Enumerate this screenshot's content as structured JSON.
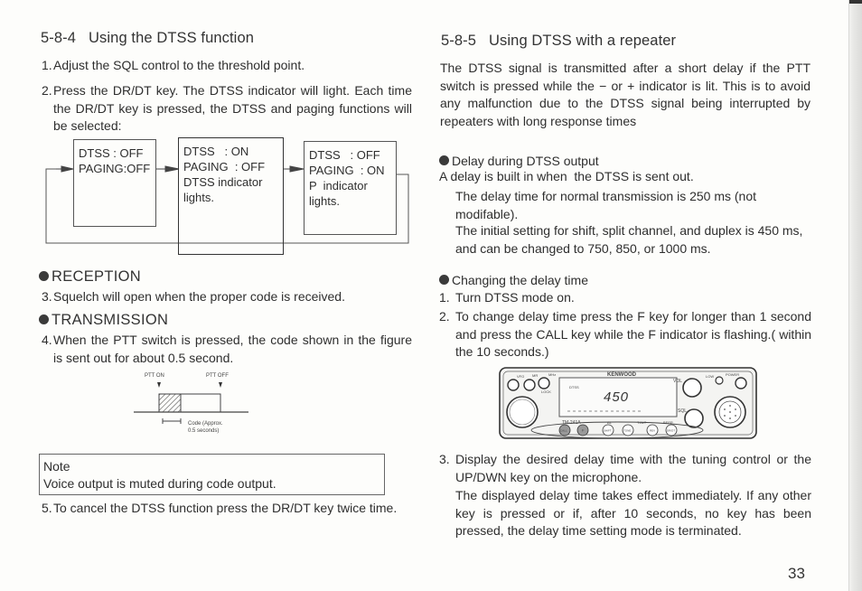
{
  "left_page": {
    "section": {
      "number": "5-8-4",
      "title": "Using the DTSS function"
    },
    "steps": [
      {
        "n": "1.",
        "text": "Adjust the SQL control to the threshold point."
      },
      {
        "n": "2.",
        "text": "Press the DR/DT key. The DTSS indicator will light. Each time the DR/DT key is pressed, the DTSS and paging functions will be selected:"
      }
    ],
    "diagram": {
      "states": [
        {
          "lines": [
            "DTSS : OFF",
            "PAGING:OFF"
          ]
        },
        {
          "lines": [
            "DTSS   : ON",
            "PAGING  : OFF",
            "DTSS indicator",
            "lights."
          ]
        },
        {
          "lines": [
            "DTSS   : OFF",
            "PAGING  : ON",
            "P  indicator",
            "lights."
          ]
        }
      ]
    },
    "reception": {
      "heading": "RECEPTION",
      "step": {
        "n": "3.",
        "text": "Squelch will open when the proper code is received."
      }
    },
    "transmission": {
      "heading": "TRANSMISSION",
      "step": {
        "n": "4.",
        "text": "When the PTT switch is pressed, the code shown in the figure is sent out for about 0.5 second."
      }
    },
    "timing_figure": {
      "ptt_on": "PTT ON",
      "ptt_off": "PTT OFF",
      "code_label_1": "Code (Approx.",
      "code_label_2": "0.5 seconds)"
    },
    "note": {
      "title": "Note",
      "text": "Voice output is muted during code output."
    },
    "step5": {
      "n": "5.",
      "text": "To cancel the DTSS function press the DR/DT key twice time."
    }
  },
  "right_page": {
    "section": {
      "number": "5-8-5",
      "title": "Using DTSS with a repeater"
    },
    "intro": "The DTSS signal is transmitted after a short delay if the PTT switch is pressed while the − or + indicator is lit. This is to avoid any malfunction due to the DTSS signal being interrupted by repeaters with long response times",
    "delay_output": {
      "heading": "Delay during DTSS output",
      "line1": "A delay is built in when  the DTSS is sent out.",
      "para1": "The delay time for normal transmission is 250 ms (not modifable).",
      "para2": "The initial setting for shift, split channel, and duplex is 450 ms, and can be changed to 750, 850, or 1000 ms."
    },
    "changing": {
      "heading": "Changing the delay time",
      "steps": [
        {
          "n": "1.",
          "text": "Turn DTSS mode on."
        },
        {
          "n": "2.",
          "text": "To change delay time press the F key for longer than 1 second and press the CALL key while the F indicator is flashing.( within the 10 seconds.)"
        }
      ]
    },
    "radio": {
      "brand": "KENWOOD",
      "model": "TM-241A",
      "display_value": "450",
      "display_small": "DTSS",
      "vol": "VOL",
      "sql": "SQL",
      "low": "LOW",
      "power": "POWER",
      "mhz": "MHz",
      "lock": "LOCK",
      "mr": "MR",
      "vfo": "VFO",
      "keys": [
        "CALL",
        "F",
        "SHIFT",
        "TONE",
        "REV",
        "DR/DT"
      ],
      "key_labels_above": [
        "AL",
        "T.ALT",
        "BEEP"
      ]
    },
    "step3": {
      "n": "3.",
      "text": "Display the desired delay time with the tuning control or the UP/DWN key on the microphone.",
      "para": "The displayed delay time takes effect immediately. If any other key is pressed or if, after 10 seconds, no key has been pressed, the delay time setting mode is terminated."
    },
    "page_number": "33"
  }
}
